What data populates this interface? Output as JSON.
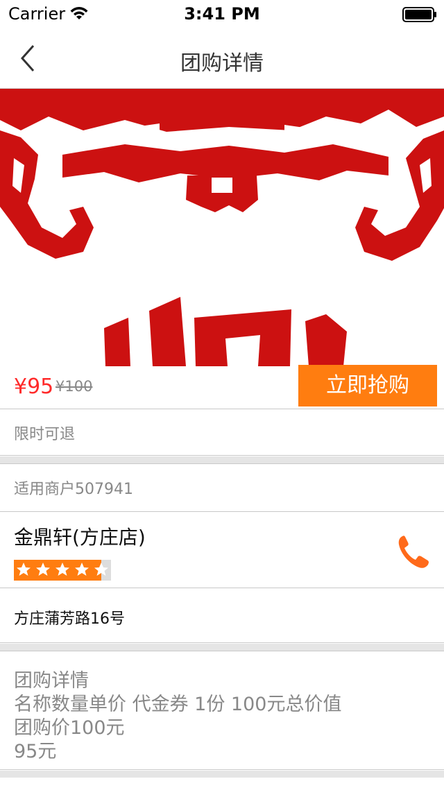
{
  "status_bar": {
    "carrier": "Carrier",
    "time": "3:41 PM"
  },
  "nav": {
    "title": "团购详情",
    "back_icon": "chevron-left-icon"
  },
  "price": {
    "current": "¥95",
    "original": "¥100",
    "buy_label": "立即抢购"
  },
  "refund": {
    "text": "限时可退"
  },
  "merchant": {
    "label": "适用商户507941"
  },
  "shop": {
    "name": "金鼎轩(方庄店)",
    "rating": 4.5,
    "max_rating": 5,
    "phone_icon": "phone-icon"
  },
  "address": {
    "text": "方庄蒲芳路16号"
  },
  "detail": {
    "lines": [
      "团购详情",
      "名称数量单价 代金券 1份 100元总价值",
      "团购价100元",
      "95元"
    ]
  },
  "colors": {
    "accent": "#ff7d10",
    "price": "#ff2a2a",
    "hero_red": "#cc1111",
    "divider": "#e5e5e5"
  }
}
